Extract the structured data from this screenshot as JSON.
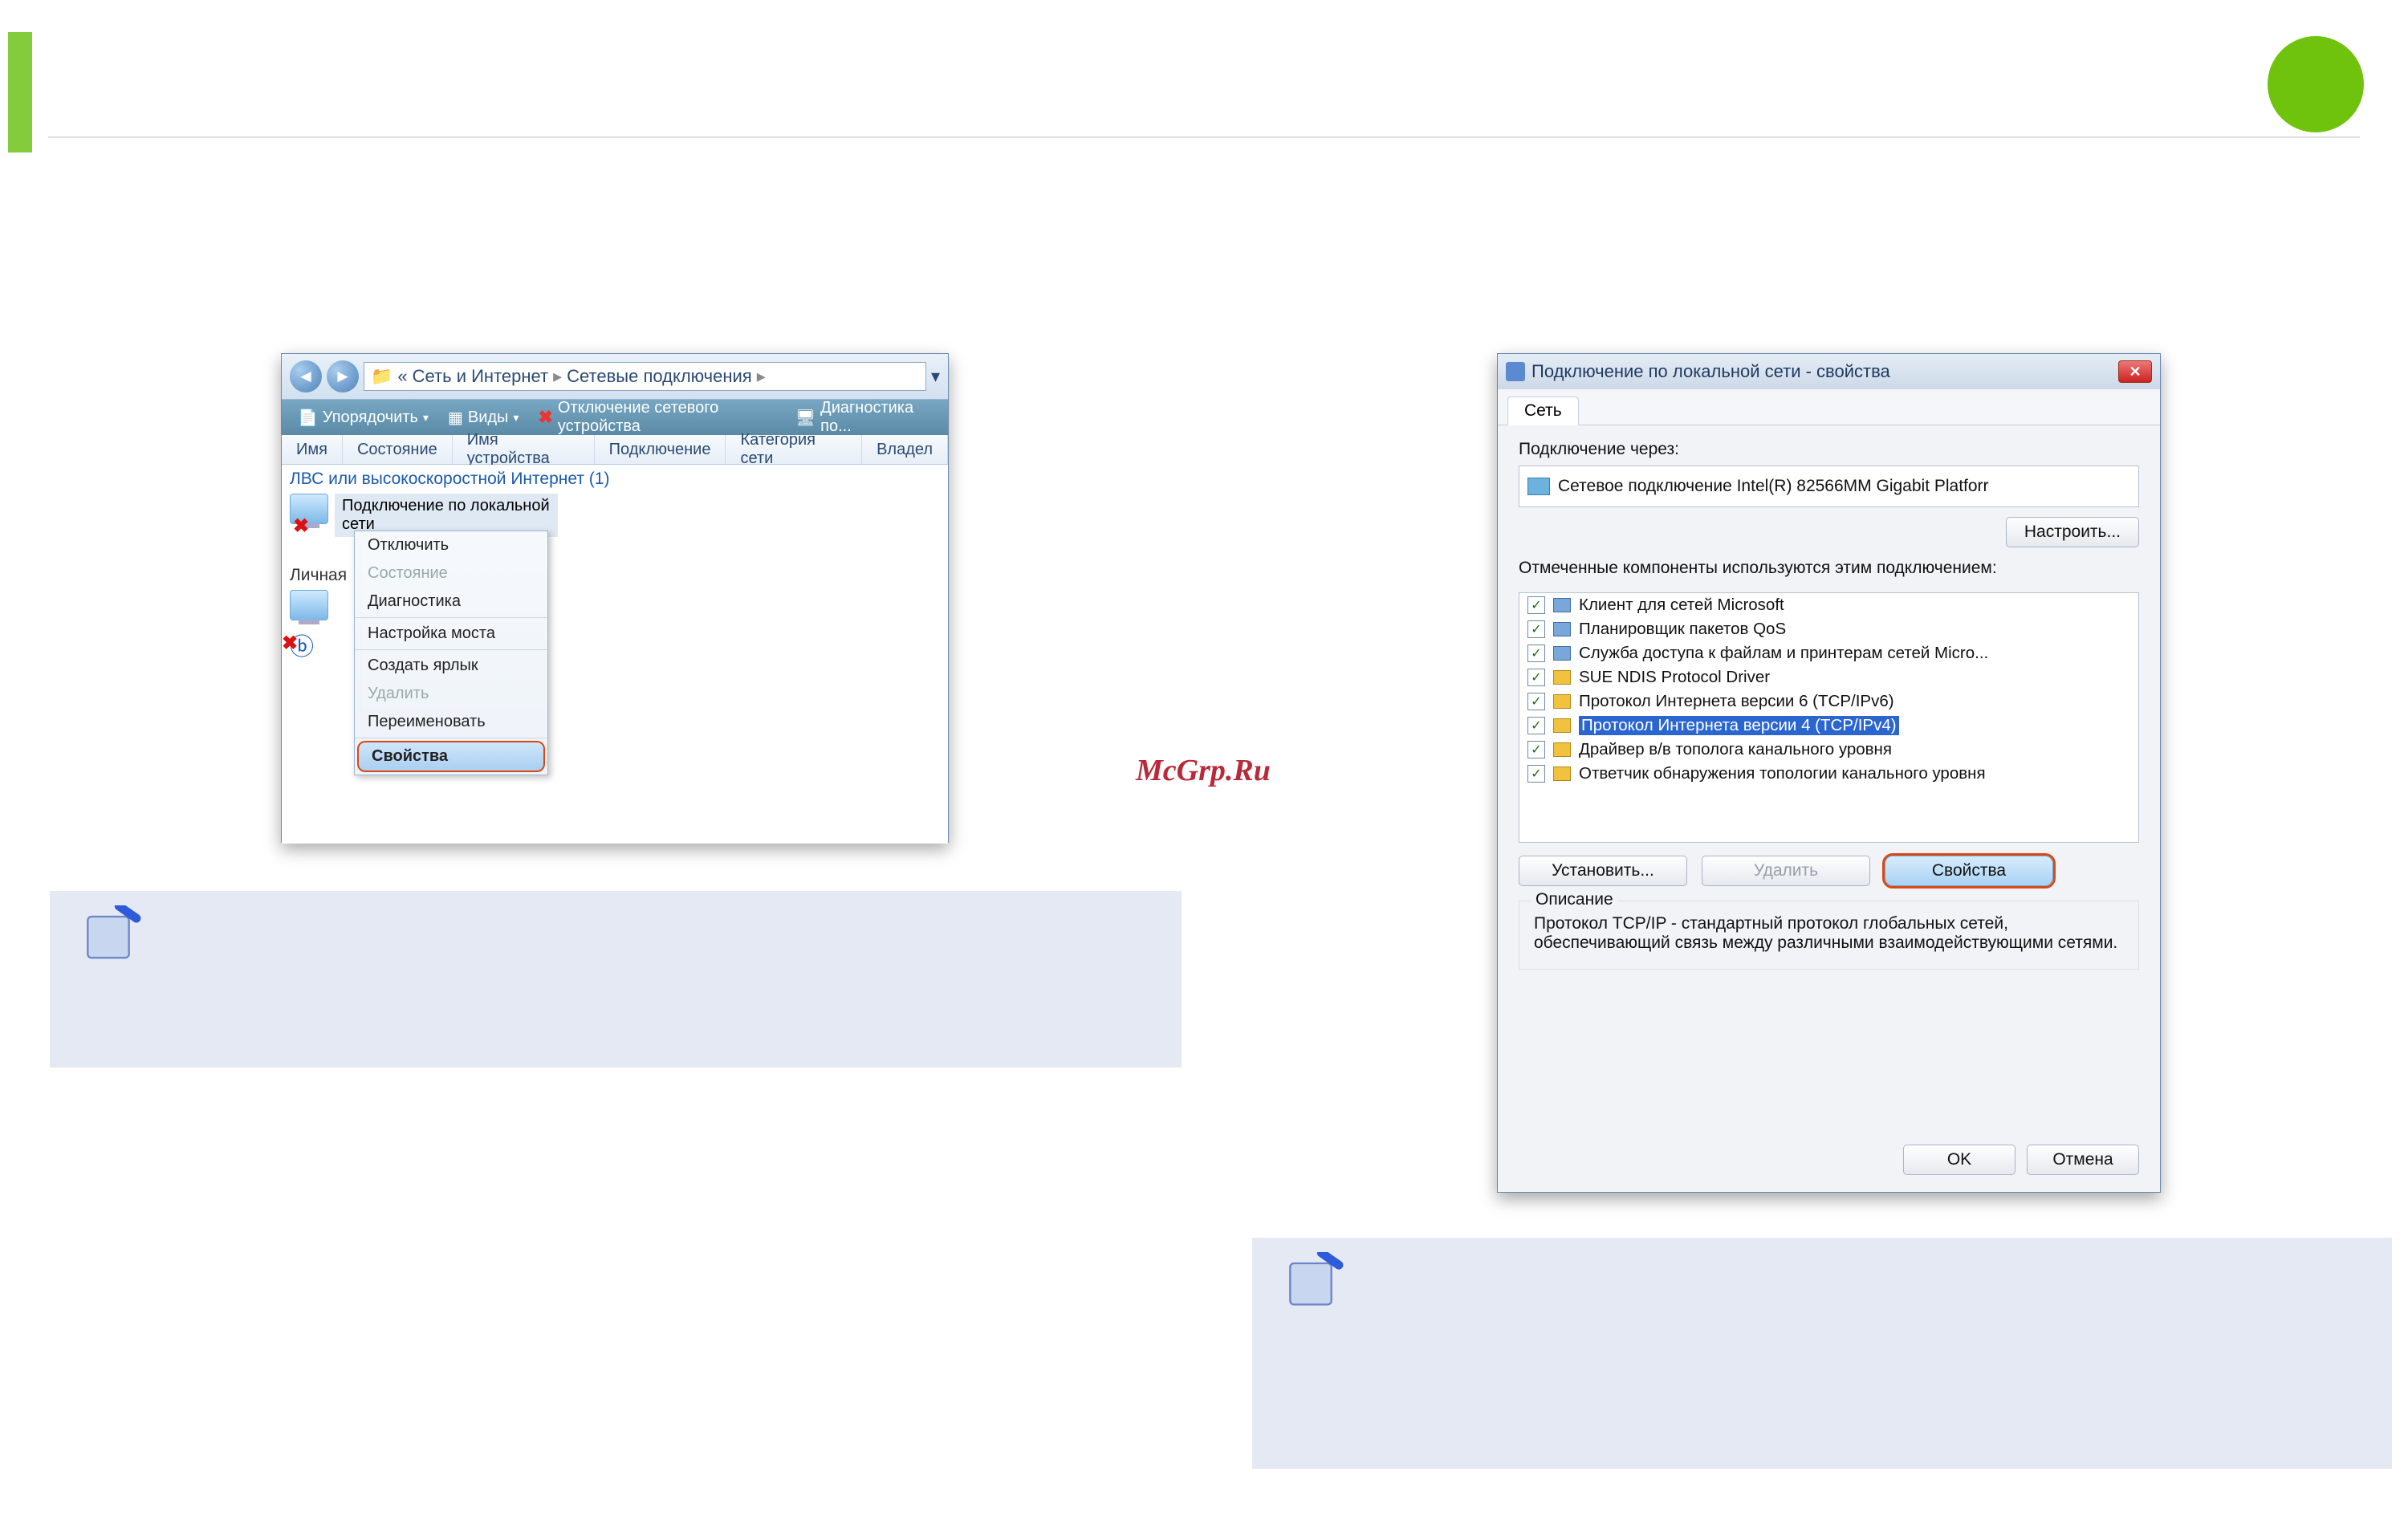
{
  "watermark": "McGrp.Ru",
  "explorer": {
    "breadcrumb_prefix": "«",
    "crumb1": "Сеть и Интернет",
    "crumb2": "Сетевые подключения",
    "crumb_sep": "▸",
    "toolbar": {
      "organize": "Упорядочить",
      "views": "Виды",
      "disable": "Отключение сетевого устройства",
      "diagnose": "Диагностика по..."
    },
    "columns": {
      "name": "Имя",
      "status": "Состояние",
      "device": "Имя устройства",
      "connectivity": "Подключение",
      "category": "Категория сети",
      "owner": "Владел"
    },
    "group_header": "ЛВС или высокоскоростной Интернет (1)",
    "connection_label": "Подключение по локальной сети",
    "personal_label": "Личная",
    "context_menu": {
      "disable": "Отключить",
      "status": "Состояние",
      "diagnose": "Диагностика",
      "bridge": "Настройка моста",
      "shortcut": "Создать ярлык",
      "delete": "Удалить",
      "rename": "Переименовать",
      "properties": "Свойства"
    }
  },
  "props": {
    "title": "Подключение по локальной сети - свойства",
    "tab": "Сеть",
    "connect_using": "Подключение через:",
    "adapter": "Сетевое подключение Intel(R) 82566MM Gigabit Platforr",
    "configure": "Настроить...",
    "components_label": "Отмеченные компоненты используются этим подключением:",
    "components": [
      "Клиент для сетей Microsoft",
      "Планировщик пакетов QoS",
      "Служба доступа к файлам и принтерам сетей Micro...",
      "SUE NDIS Protocol Driver",
      "Протокол Интернета версии 6 (TCP/IPv6)",
      "Протокол Интернета версии 4 (TCP/IPv4)",
      "Драйвер в/в тополога канального уровня",
      "Ответчик обнаружения топологии канального уровня"
    ],
    "install": "Установить...",
    "uninstall": "Удалить",
    "properties": "Свойства",
    "desc_legend": "Описание",
    "desc_text": "Протокол TCP/IP - стандартный протокол глобальных сетей, обеспечивающий связь между различными взаимодействующими сетями.",
    "ok": "OK",
    "cancel": "Отмена"
  }
}
